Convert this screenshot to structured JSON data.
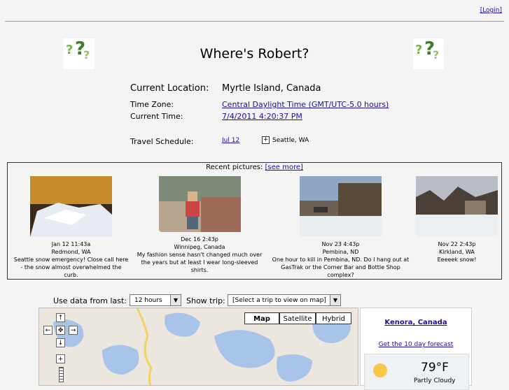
{
  "header": {
    "login_link": "[Login]",
    "title": "Where's Robert?"
  },
  "info": {
    "location_label": "Current Location:",
    "location_value": "Myrtle Island, Canada",
    "timezone_label": "Time Zone:",
    "timezone_value": "Central Daylight Time (GMT/UTC-5.0 hours)",
    "time_label": "Current Time:",
    "time_value": "7/4/2011 4:20:37 PM",
    "schedule_label": "Travel Schedule:",
    "schedule_date": "Jul 12",
    "schedule_dest": "Seattle, WA"
  },
  "recent": {
    "label": "Recent pictures:",
    "see_more": "[see more]",
    "pictures": [
      {
        "date": "Jan 12 11:43a",
        "place": "Redmond, WA",
        "caption": "Seattle snow emergency! Close call here - the snow almost overwhelmed the curb."
      },
      {
        "date": "Dec 16 2:43p",
        "place": "Winnipeg, Canada",
        "caption": "My fashion sense hasn't changed much over the years but at least I wear long-sleeved shirts."
      },
      {
        "date": "Nov 23 4:43p",
        "place": "Pembina, ND",
        "caption": "One hour to kill in Pembina, ND. Do I hang out at GasTrak or the Corner Bar and Bottle Shop complex?"
      },
      {
        "date": "Nov 22 2:43p",
        "place": "Kirkland, WA",
        "caption": "Eeeeek snow!"
      }
    ]
  },
  "controls": {
    "use_data_label": "Use data from last:",
    "use_data_value": "12 hours",
    "show_trip_label": "Show trip:",
    "show_trip_value": "[Select a trip to view on map]"
  },
  "map": {
    "type_map": "Map",
    "type_satellite": "Satellite",
    "type_hybrid": "Hybrid"
  },
  "weather": {
    "location": "Kenora, Canada",
    "forecast_link": "Get the 10 day forecast",
    "temp": "79°F",
    "condition": "Partly Cloudy"
  }
}
